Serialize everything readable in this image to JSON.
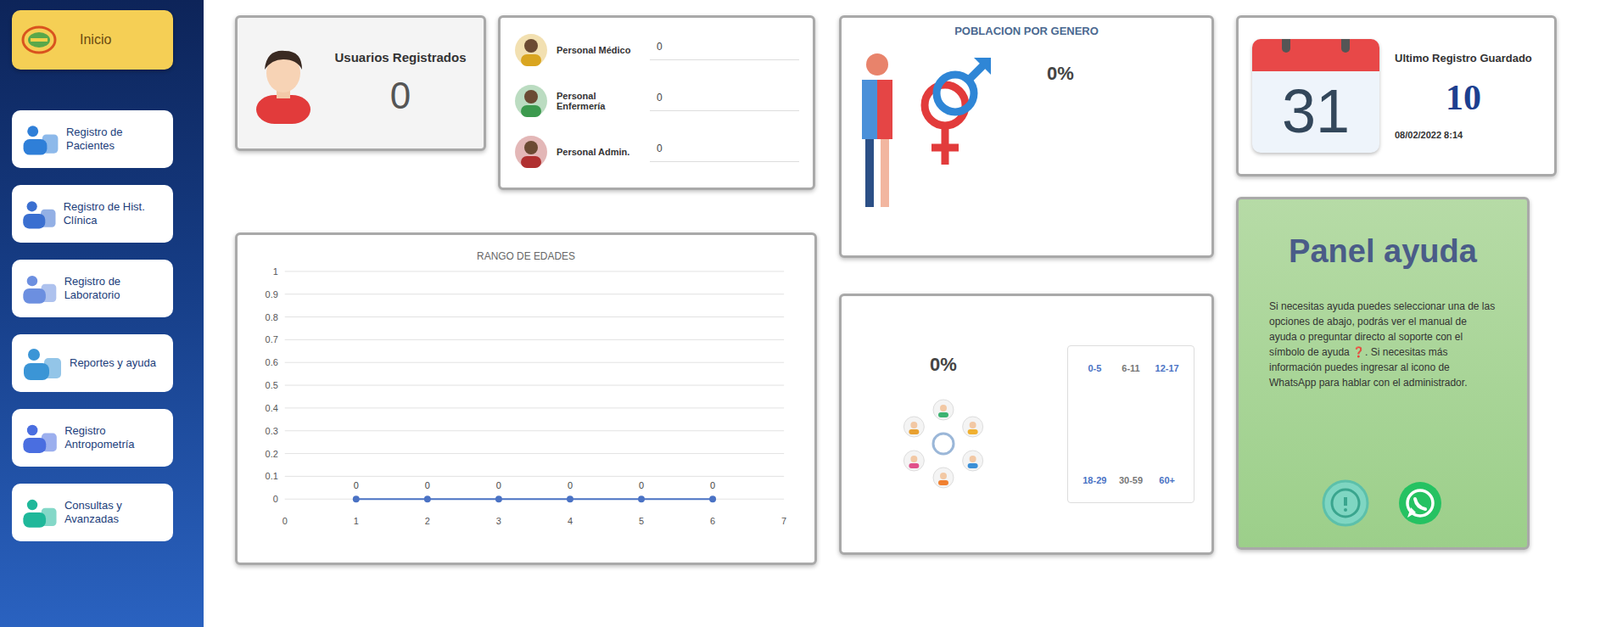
{
  "sidebar": {
    "home": {
      "label": "Inicio",
      "selected": true
    },
    "items": [
      {
        "label": "Registro de Pacientes",
        "selected": false
      },
      {
        "label": "Registro de Hist. Clínica",
        "selected": false
      },
      {
        "label": "Registro de Laboratorio",
        "selected": false
      },
      {
        "label": "Reportes y ayuda",
        "selected": false
      },
      {
        "label": "Registro Antropometría",
        "selected": false
      },
      {
        "label": "Consultas y Avanzadas",
        "selected": false
      }
    ]
  },
  "users_card": {
    "title": "Usuarios Registrados",
    "count": "0"
  },
  "roles_card": {
    "rows": [
      {
        "label": "Personal Médico",
        "value": "0",
        "color": "#d9a520"
      },
      {
        "label": "Personal Enfermería",
        "value": "0",
        "color": "#3c9a4e"
      },
      {
        "label": "Personal Admin.",
        "value": "0",
        "color": "#b03030"
      }
    ]
  },
  "gender_card": {
    "title": "POBLACION POR GENERO",
    "percent": "0%"
  },
  "calendar_card": {
    "day": "31",
    "title": "Ultimo Registro Guardado",
    "count": "10",
    "datetime": "08/02/2022 8:14"
  },
  "age_chart": {
    "title": "RANGO DE EDADES",
    "y_ticks": [
      "0",
      "0.1",
      "0.2",
      "0.3",
      "0.4",
      "0.5",
      "0.6",
      "0.7",
      "0.8",
      "0.9",
      "1"
    ],
    "x_ticks": [
      "0",
      "1",
      "2",
      "3",
      "4",
      "5",
      "6",
      "7"
    ],
    "series": [
      {
        "values": [
          0,
          0,
          0,
          0,
          0,
          0
        ],
        "point_labels": [
          "0",
          "0",
          "0",
          "0",
          "0",
          "0"
        ],
        "color": "#4a72c4"
      }
    ]
  },
  "age_card": {
    "percent": "0%",
    "legend": [
      {
        "label": "0-5",
        "color": "#4a72c4"
      },
      {
        "label": "6-11",
        "color": "#777777"
      },
      {
        "label": "12-17",
        "color": "#4a72c4"
      },
      {
        "label": "18-29",
        "color": "#4a72c4"
      },
      {
        "label": "30-59",
        "color": "#777777"
      },
      {
        "label": "60+",
        "color": "#4a72c4"
      }
    ]
  },
  "help_panel": {
    "title": "Panel ayuda",
    "text": "Si necesitas ayuda puedes seleccionar una de las opciones de abajo, podrás ver el manual de ayuda o preguntar directo al soporte con el símbolo de ayuda ❓. Si necesitas más información puedes ingresar al icono de WhatsApp para hablar con el administrador."
  }
}
